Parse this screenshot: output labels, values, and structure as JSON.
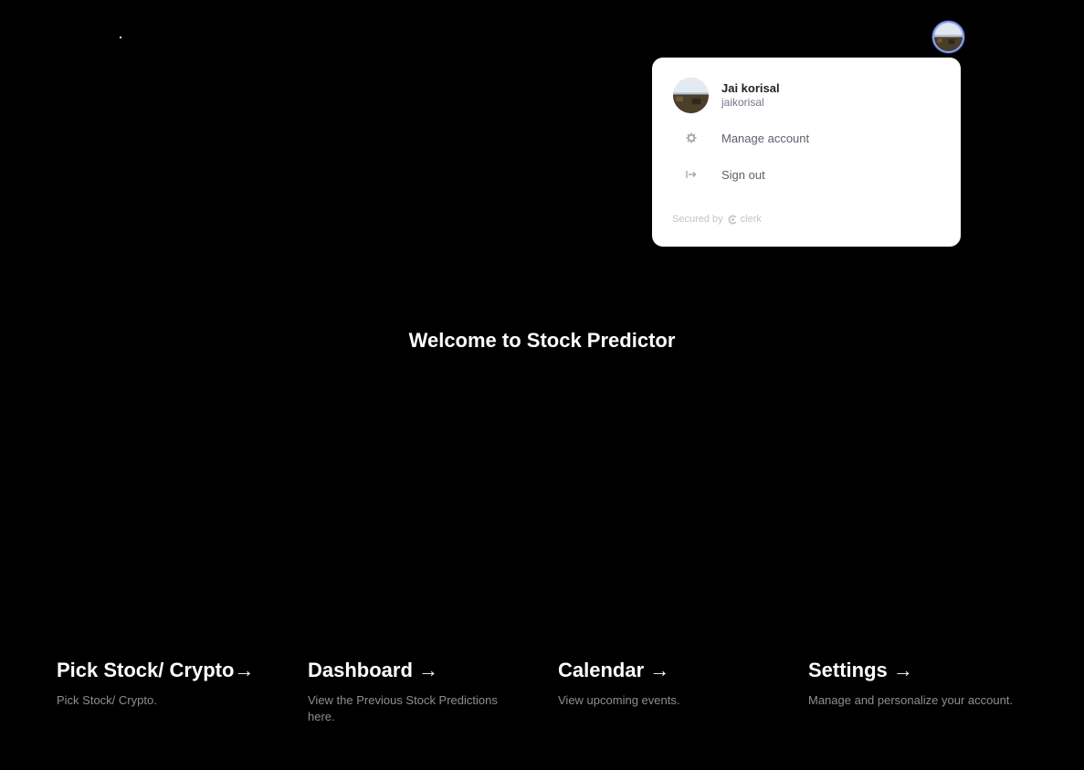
{
  "header": {
    "avatar_icon": "user-avatar-icon"
  },
  "user_menu": {
    "name": "Jai korisal",
    "handle": "jaikorisal",
    "items": [
      {
        "label": "Manage account",
        "icon": "gear-icon"
      },
      {
        "label": "Sign out",
        "icon": "sign-out-icon"
      }
    ],
    "secured_by": "Secured by",
    "provider": "clerk"
  },
  "main": {
    "welcome": "Welcome to Stock Predictor"
  },
  "cards": [
    {
      "title": "Pick Stock/ Crypto",
      "arrow": "→",
      "description": "Pick Stock/ Crypto."
    },
    {
      "title": "Dashboard",
      "arrow": "→",
      "description": "View the Previous Stock Predictions here."
    },
    {
      "title": "Calendar",
      "arrow": "→",
      "description": "View upcoming events."
    },
    {
      "title": "Settings",
      "arrow": "→",
      "description": "Manage and personalize your account."
    }
  ],
  "colors": {
    "background": "#000000",
    "popover": "#ffffff",
    "accent_ring": "#8ea6ff",
    "muted_text": "#8e8e8e"
  }
}
